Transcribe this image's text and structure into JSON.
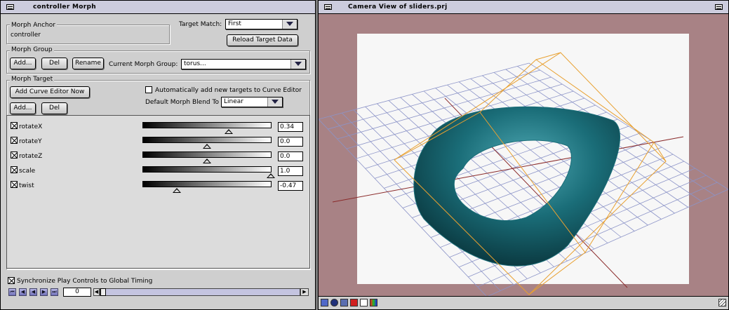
{
  "morph_window": {
    "title": "controller Morph",
    "anchor": {
      "label": "Morph Anchor",
      "value": "controller"
    },
    "target_match": {
      "label": "Target Match:",
      "value": "First"
    },
    "reload_button": "Reload Target Data",
    "group": {
      "label": "Morph Group",
      "add": "Add...",
      "del": "Del",
      "rename": "Rename",
      "current_label": "Current Morph Group:",
      "current_value": "torus..."
    },
    "target": {
      "label": "Morph Target",
      "add_curve_button": "Add Curve Editor Now",
      "auto_add_label": "Automatically add new targets to Curve Editor",
      "auto_add_checked": false,
      "add": "Add...",
      "del": "Del",
      "blend_label": "Default Morph Blend To",
      "blend_value": "Linear"
    },
    "sliders": [
      {
        "name": "rotateX",
        "checked": true,
        "value": "0.34",
        "position": 0.67
      },
      {
        "name": "rotateY",
        "checked": true,
        "value": "0.0",
        "position": 0.5
      },
      {
        "name": "rotateZ",
        "checked": true,
        "value": "0.0",
        "position": 0.5
      },
      {
        "name": "scale",
        "checked": true,
        "value": "1.0",
        "position": 1.0
      },
      {
        "name": "twist",
        "checked": true,
        "value": "-0.47",
        "position": 0.265
      }
    ],
    "sync_label": "Synchronize Play Controls to Global Timing",
    "sync_checked": true,
    "timeline": {
      "frame": "0",
      "position": 0.0
    }
  },
  "camera_window": {
    "title": "Camera View of sliders.prj"
  },
  "colors": {
    "torus": "#1a6d78",
    "grid": "#8c94c8",
    "axis": "#8a2a2a",
    "bbox": "#e8a030",
    "background": "#a88285"
  }
}
